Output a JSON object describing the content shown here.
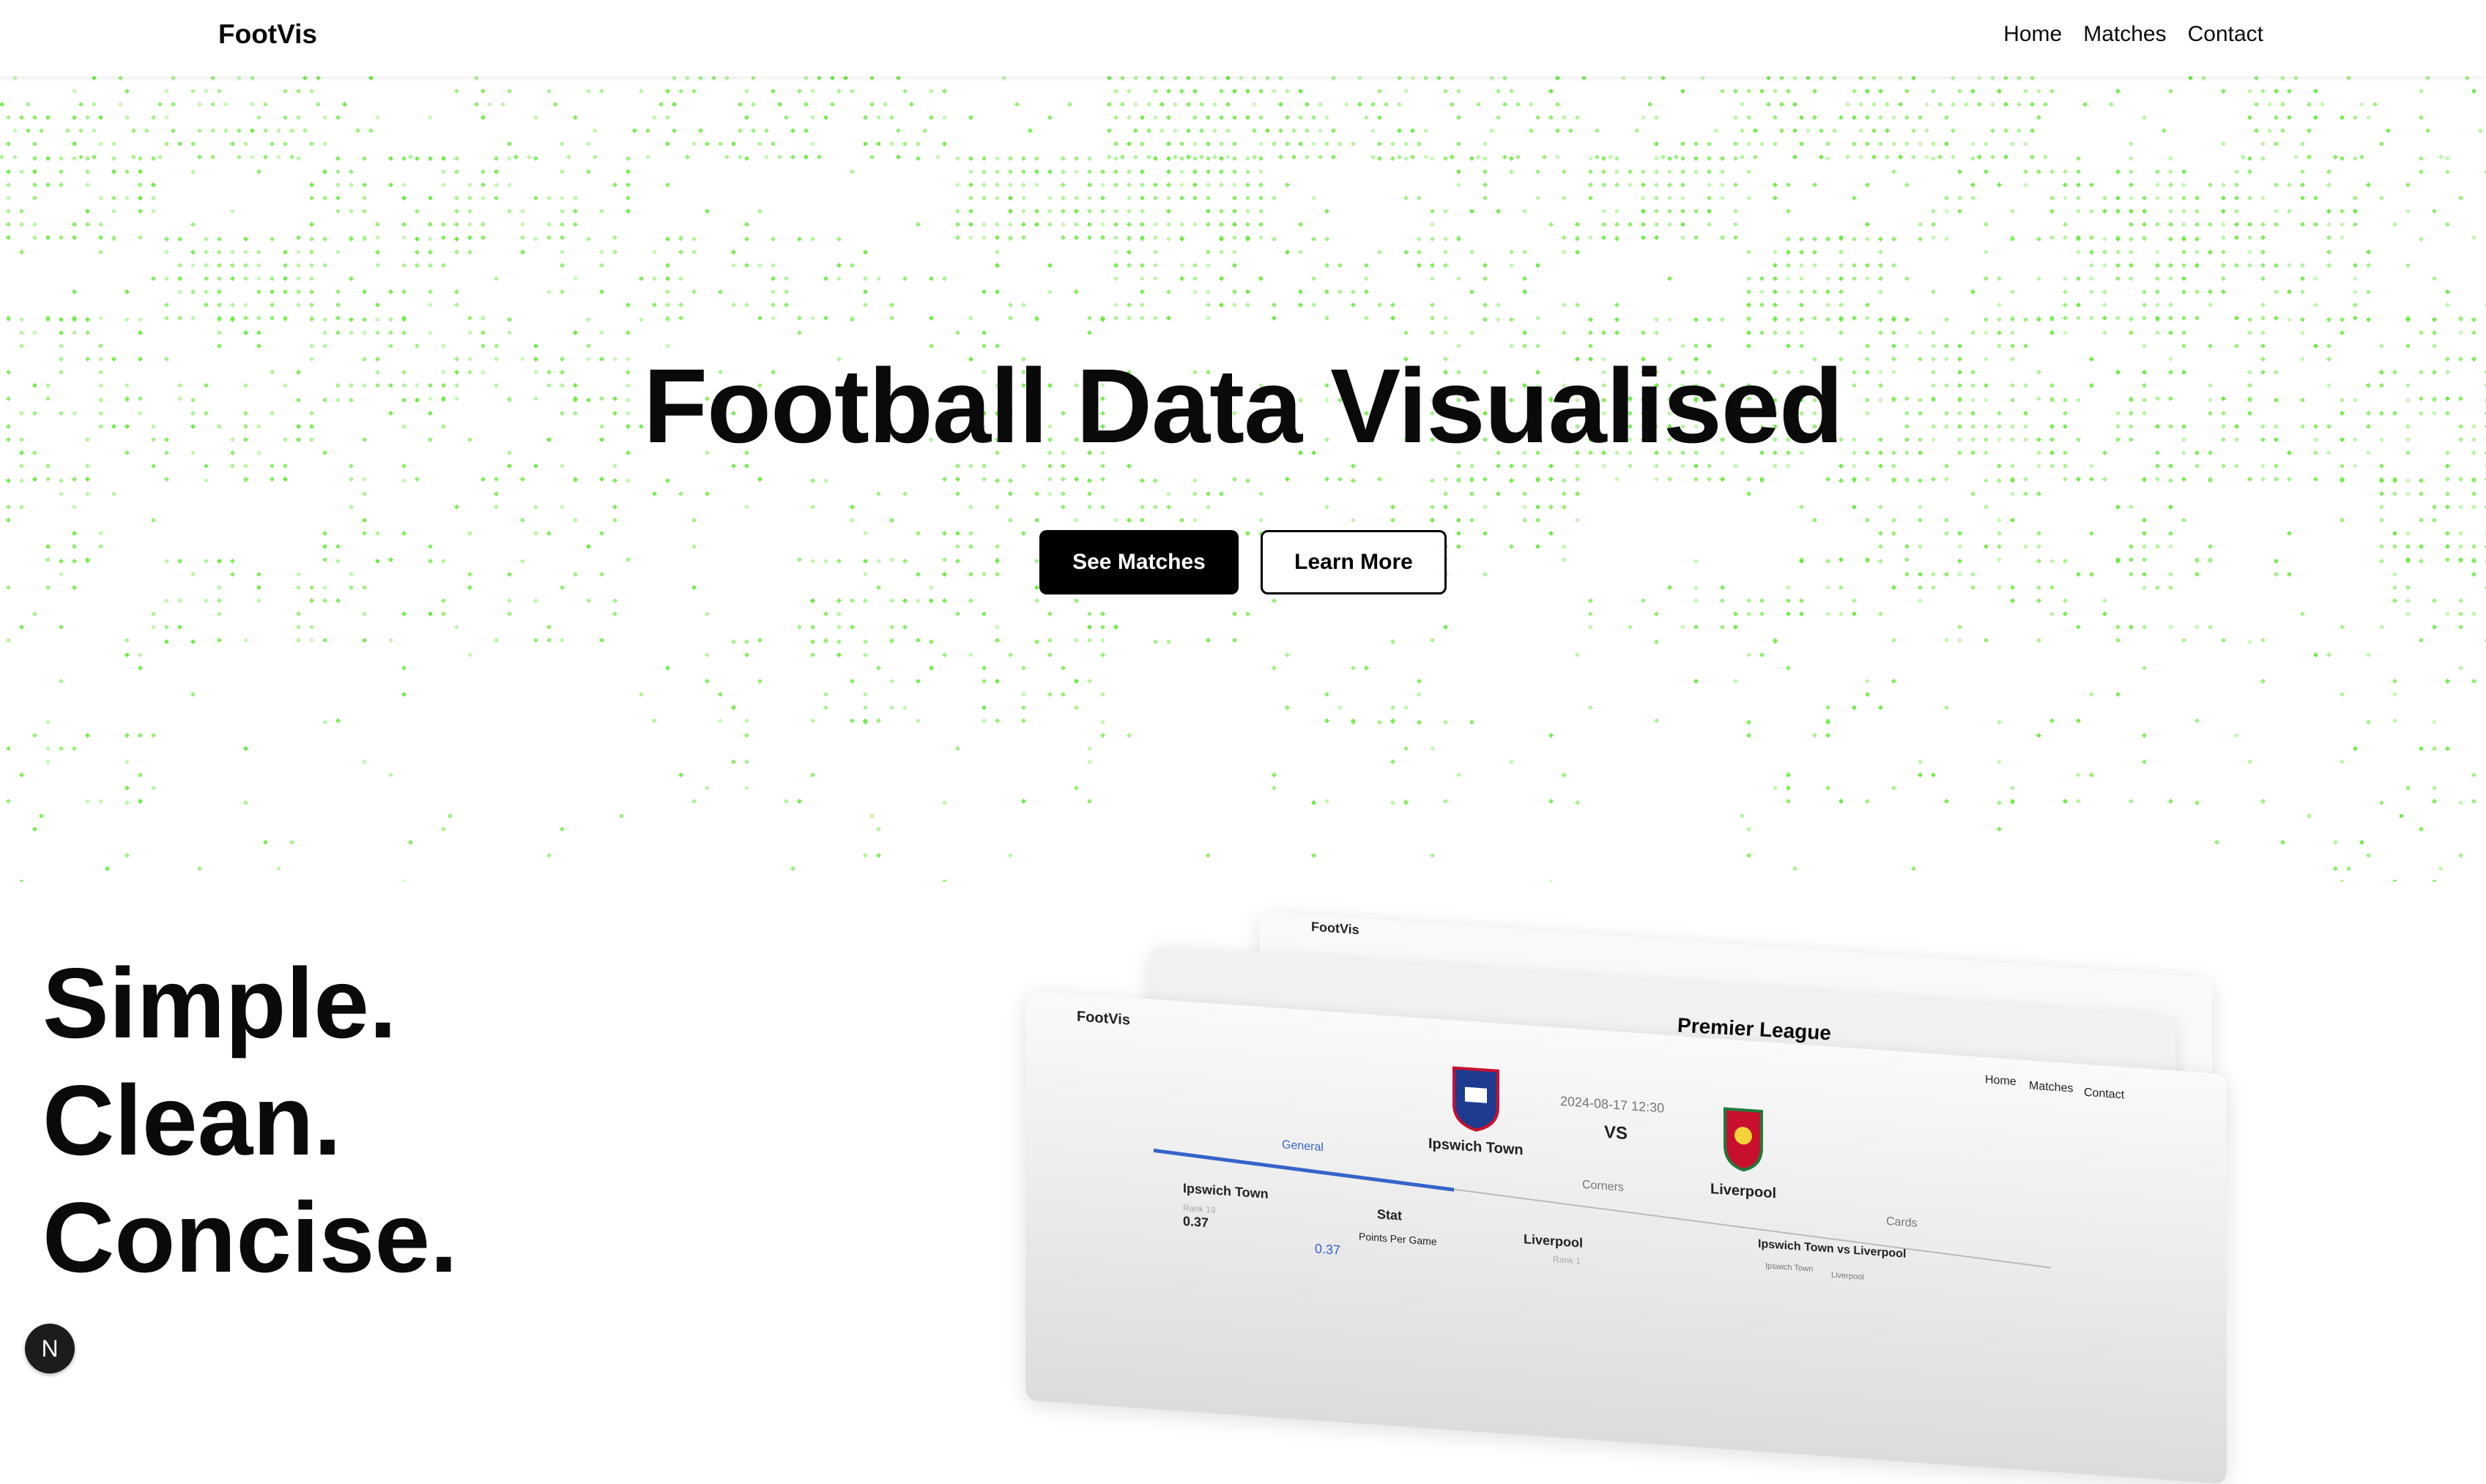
{
  "nav": {
    "brand": "FootVis",
    "links": [
      "Home",
      "Matches",
      "Contact"
    ]
  },
  "hero": {
    "title": "Football Data Visualised",
    "primary_button": "See Matches",
    "secondary_button": "Learn More"
  },
  "tagline": [
    "Simple.",
    "Clean.",
    "Concise."
  ],
  "preview": {
    "brand_top": "FootVis",
    "league": "Premier League",
    "brand": "FootVis",
    "nav_links": [
      "Home",
      "Matches",
      "Contact"
    ],
    "home_team": "Ipswich Town",
    "away_team": "Liverpool",
    "datetime": "2024-08-17 12:30",
    "vs": "VS",
    "tabs": [
      "General",
      "Corners",
      "Cards"
    ],
    "stat_header": "Stat",
    "stat_row": "Points Per Game",
    "home_rank": "Rank 19",
    "home_value": "0.37",
    "away_rank": "Rank 1",
    "bar_value": "0.37",
    "comparison_title": "Ipswich Town vs Liverpool",
    "legend": [
      "Ipswich Town",
      "Liverpool"
    ]
  },
  "badge": "N",
  "colors": {
    "accent_green": "#66e83a",
    "dark": "#000000"
  }
}
